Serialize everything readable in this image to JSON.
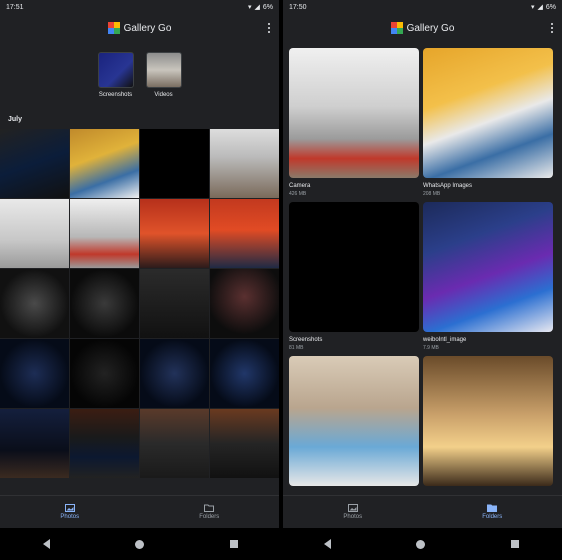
{
  "left": {
    "status": {
      "time": "17:51",
      "battery": "6%"
    },
    "app_title": "Gallery Go",
    "quick_tiles": [
      {
        "label": "Screenshots"
      },
      {
        "label": "Videos"
      }
    ],
    "section": "July",
    "bottom_nav": {
      "photos": "Photos",
      "folders": "Folders"
    }
  },
  "right": {
    "status": {
      "time": "17:50",
      "battery": "6%"
    },
    "app_title": "Gallery Go",
    "folders": [
      {
        "name": "Camera",
        "size": "426 MB"
      },
      {
        "name": "WhatsApp Images",
        "size": "208 MB"
      },
      {
        "name": "Screenshots",
        "size": "81 MB"
      },
      {
        "name": "weiboIntl_image",
        "size": "7.9 MB"
      }
    ],
    "bottom_nav": {
      "photos": "Photos",
      "folders": "Folders"
    }
  },
  "colors": {
    "accent": "#8ab4f8",
    "background": "#202124"
  }
}
